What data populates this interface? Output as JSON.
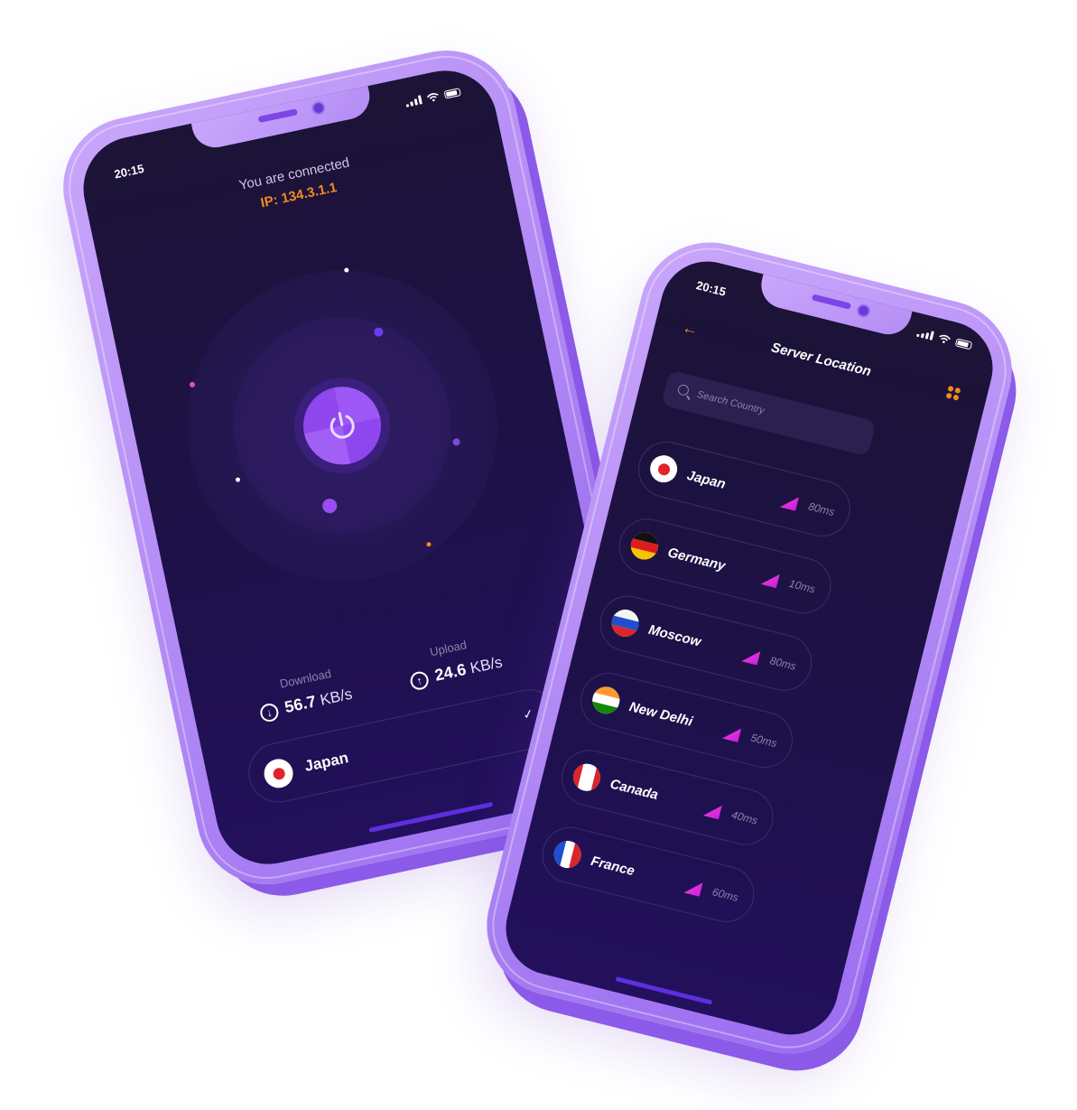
{
  "phone1": {
    "status_time": "20:15",
    "connection_status": "You are connected",
    "ip": "IP: 134.3.1.1",
    "download": {
      "label": "Download",
      "value": "56.7",
      "unit": "KB/s"
    },
    "upload": {
      "label": "Upload",
      "value": "24.6",
      "unit": "KB/s"
    },
    "selected_country": "Japan"
  },
  "phone2": {
    "status_time": "20:15",
    "title": "Server Location",
    "search_placeholder": "Search Country",
    "servers": [
      {
        "name": "Japan",
        "ping": "80ms",
        "flag": "japan-flag-icon"
      },
      {
        "name": "Germany",
        "ping": "10ms",
        "flag": "germany-flag-icon"
      },
      {
        "name": "Moscow",
        "ping": "80ms",
        "flag": "russia-flag-icon"
      },
      {
        "name": "New Delhi",
        "ping": "50ms",
        "flag": "india-flag-icon"
      },
      {
        "name": "Canada",
        "ping": "40ms",
        "flag": "canada-flag-icon"
      },
      {
        "name": "France",
        "ping": "60ms",
        "flag": "france-flag-icon"
      }
    ]
  },
  "colors": {
    "accent_orange": "#f38a1f",
    "accent_purple": "#9d57f5",
    "screen_background": "#1d1148",
    "phone_body": "#b48cf5",
    "signal_pink": "#ff3fd2"
  }
}
